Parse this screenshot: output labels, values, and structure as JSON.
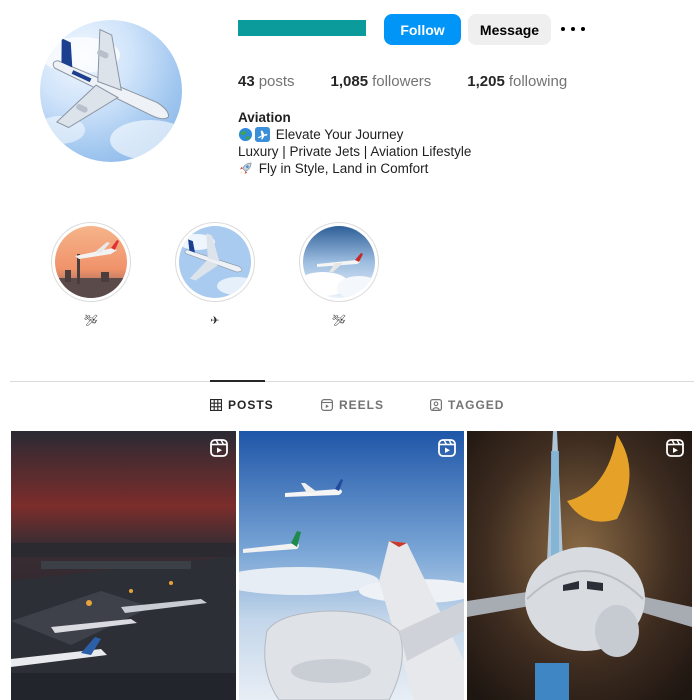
{
  "profile": {
    "follow_label": "Follow",
    "message_label": "Message",
    "username_bar_color": "#0b9b9b",
    "accent_color": "#0095f6"
  },
  "stats": {
    "posts_count": "43",
    "posts_label": "posts",
    "followers_count": "1,085",
    "followers_label": "followers",
    "following_count": "1,205",
    "following_label": "following"
  },
  "bio": {
    "name": "Aviation",
    "line1": "Elevate Your Journey",
    "line2": "Luxury | Private Jets | Aviation Lifestyle",
    "line3": "Fly in Style, Land in Comfort",
    "line1_icons": [
      "globe-icon",
      "airplane-icon"
    ],
    "line3_icon": "rocket-icon"
  },
  "highlights": [
    {
      "label": "🛩",
      "icon": "plane-emoji"
    },
    {
      "label": "✈",
      "icon": "plane-emoji"
    },
    {
      "label": "🛩",
      "icon": "plane-emoji"
    }
  ],
  "tabs": [
    {
      "label": "POSTS",
      "icon": "grid-icon",
      "active": true
    },
    {
      "label": "REELS",
      "icon": "reels-icon",
      "active": false
    },
    {
      "label": "TAGGED",
      "icon": "tagged-icon",
      "active": false
    }
  ],
  "posts": [
    {
      "type": "reel",
      "icon": "reel-icon"
    },
    {
      "type": "reel",
      "icon": "reel-icon"
    },
    {
      "type": "reel",
      "icon": "reel-icon"
    }
  ]
}
